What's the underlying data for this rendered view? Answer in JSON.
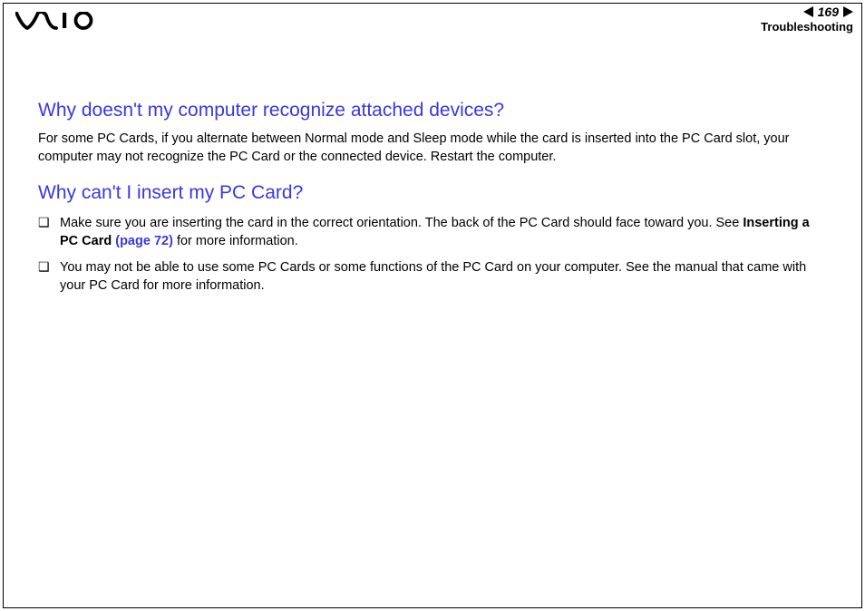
{
  "header": {
    "page_number": "169",
    "section": "Troubleshooting"
  },
  "content": {
    "heading1": "Why doesn't my computer recognize attached devices?",
    "para1": "For some PC Cards, if you alternate between Normal mode and Sleep mode while the card is inserted into the PC Card slot, your computer may not recognize the PC Card or the connected device. Restart the computer.",
    "heading2": "Why can't I insert my PC Card?",
    "bullets": [
      {
        "text_before": "Make sure you are inserting the card in the correct orientation. The back of the PC Card should face toward you. See ",
        "bold": "Inserting a PC Card ",
        "link": "(page 72)",
        "text_after": " for more information."
      },
      {
        "text_full": "You may not be able to use some PC Cards or some functions of the PC Card on your computer. See the manual that came with your PC Card for more information."
      }
    ]
  }
}
